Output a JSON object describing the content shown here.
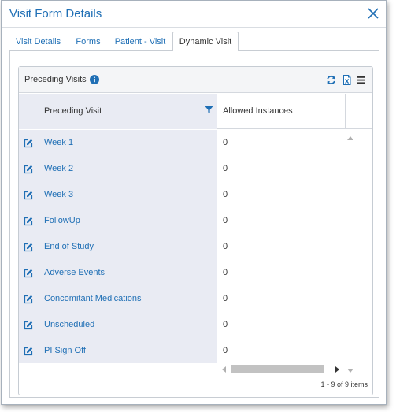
{
  "dialog": {
    "title": "Visit Form Details",
    "close_icon": "close-icon"
  },
  "tabs": [
    {
      "label": "Visit Details",
      "active": false
    },
    {
      "label": "Forms",
      "active": false
    },
    {
      "label": "Patient - Visit",
      "active": false
    },
    {
      "label": "Dynamic Visit",
      "active": true
    }
  ],
  "panel": {
    "title": "Preceding Visits",
    "icons": [
      "info-icon",
      "refresh-icon",
      "excel-export-icon",
      "menu-icon"
    ]
  },
  "grid": {
    "columns": [
      "Preceding Visit",
      "Allowed Instances"
    ],
    "rows": [
      {
        "visit": "Week 1",
        "instances": "0"
      },
      {
        "visit": "Week 2",
        "instances": "0"
      },
      {
        "visit": "Week 3",
        "instances": "0"
      },
      {
        "visit": "FollowUp",
        "instances": "0"
      },
      {
        "visit": "End of Study",
        "instances": "0"
      },
      {
        "visit": "Adverse Events",
        "instances": "0"
      },
      {
        "visit": "Concomitant Medications",
        "instances": "0"
      },
      {
        "visit": "Unscheduled",
        "instances": "0"
      },
      {
        "visit": "PI Sign Off",
        "instances": "0"
      }
    ],
    "pager_text": "1 - 9 of 9 items"
  },
  "colors": {
    "accent": "#1f6fb5",
    "left_column_bg": "#e9ebf3",
    "header_bg": "#f4f5f7"
  }
}
